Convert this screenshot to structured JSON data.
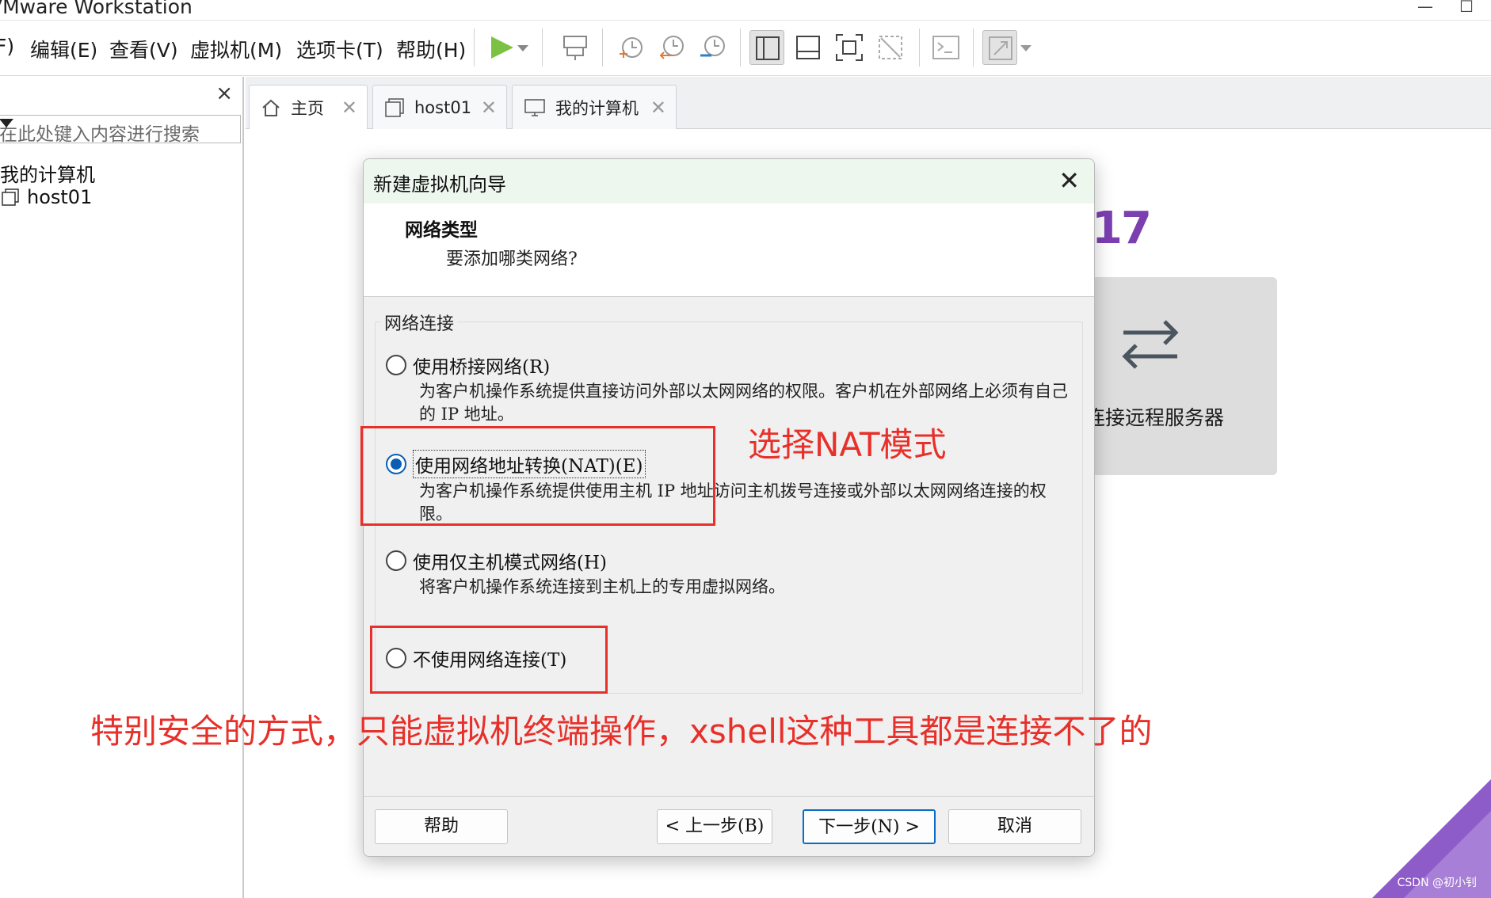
{
  "window": {
    "title": "VMware Workstation",
    "minimize": "—",
    "maximize": "☐"
  },
  "menu": [
    "F)",
    "编辑(E)",
    "查看(V)",
    "虚拟机(M)",
    "选项卡(T)",
    "帮助(H)"
  ],
  "toolbar": {
    "icons": [
      "play-icon",
      "play-dropdown-icon",
      "send-keys-icon",
      "snapshot-take-icon",
      "snapshot-revert-icon",
      "snapshot-manager-icon",
      "library-view-icon",
      "thumbnail-bar-icon",
      "fullscreen-icon",
      "unity-icon",
      "console-icon",
      "stretch-guest-icon"
    ]
  },
  "sidebar": {
    "close": "×",
    "search_placeholder": "在此处键入内容进行搜索",
    "tree_root": "我的计算机",
    "tree_child": "host01"
  },
  "tabs": [
    {
      "label": "主页",
      "close": "✕"
    },
    {
      "label": "host01",
      "close": "✕"
    },
    {
      "label": "我的计算机",
      "close": "✕"
    }
  ],
  "home": {
    "version_fragment": "17",
    "remote_card_label": "连接远程服务器"
  },
  "dialog": {
    "title": "新建虚拟机向导",
    "close": "✕",
    "header_title": "网络类型",
    "header_subtitle": "要添加哪类网络?",
    "group_label": "网络连接",
    "options": [
      {
        "label": "使用桥接网络(R)",
        "desc": "为客户机操作系统提供直接访问外部以太网网络的权限。客户机在外部网络上必须有自己的 IP 地址。",
        "checked": false
      },
      {
        "label": "使用网络地址转换(NAT)(E)",
        "desc": "为客户机操作系统提供使用主机 IP 地址访问主机拨号连接或外部以太网网络连接的权限。",
        "checked": true
      },
      {
        "label": "使用仅主机模式网络(H)",
        "desc": "将客户机操作系统连接到主机上的专用虚拟网络。",
        "checked": false
      },
      {
        "label": "不使用网络连接(T)",
        "desc": "",
        "checked": false
      }
    ],
    "buttons": {
      "help": "帮助",
      "back": "< 上一步(B)",
      "next": "下一步(N) >",
      "cancel": "取消"
    }
  },
  "annotations": {
    "nat_note": "选择NAT模式",
    "no_network_note": "特别安全的方式，只能虚拟机终端操作，xshell这种工具都是连接不了的",
    "color": "#e8302a"
  },
  "watermark": "CSDN @初小钊"
}
